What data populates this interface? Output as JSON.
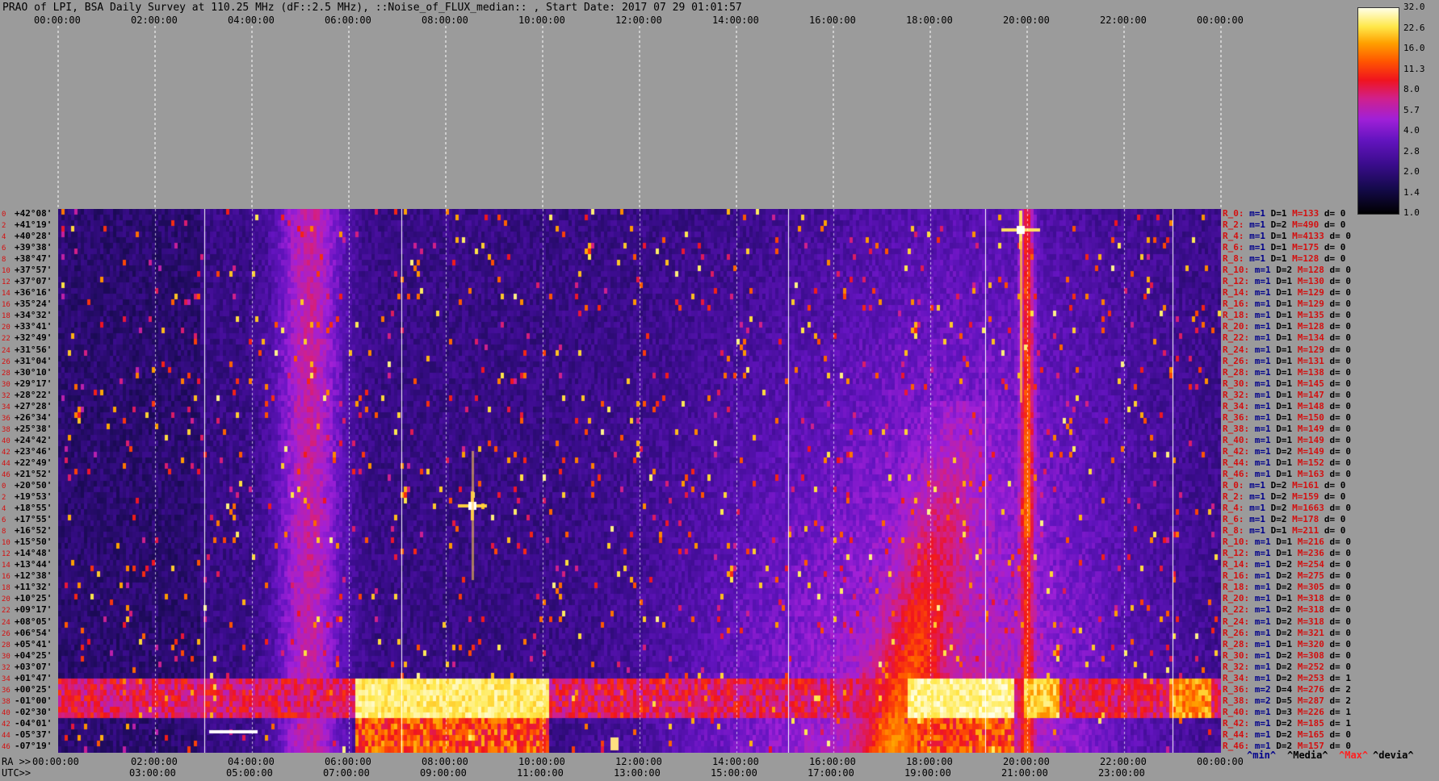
{
  "title": "PRAO of LPI, BSA Daily Survey at 110.25 MHz (dF::2.5 MHz), ::Noise_of_FLUX_median:: , Start Date: 2017 07 29 01:01:57",
  "top_ticks": [
    "00:00:00",
    "02:00:00",
    "04:00:00",
    "06:00:00",
    "08:00:00",
    "10:00:00",
    "12:00:00",
    "14:00:00",
    "16:00:00",
    "18:00:00",
    "20:00:00",
    "22:00:00",
    "00:00:00"
  ],
  "ra_prefix": "RA >>",
  "ra_ticks": [
    "00:00:00",
    "02:00:00",
    "04:00:00",
    "06:00:00",
    "08:00:00",
    "10:00:00",
    "12:00:00",
    "14:00:00",
    "16:00:00",
    "18:00:00",
    "20:00:00",
    "22:00:00",
    "00:00:00"
  ],
  "utc_prefix": "UTC>>",
  "utc_ticks": [
    "03:00:00",
    "05:00:00",
    "07:00:00",
    "09:00:00",
    "11:00:00",
    "13:00:00",
    "15:00:00",
    "17:00:00",
    "19:00:00",
    "21:00:00",
    "23:00:00"
  ],
  "colorbar": {
    "ticks": [
      "32.0",
      "22.6",
      "16.0",
      "11.3",
      "8.0",
      "5.7",
      "4.0",
      "2.8",
      "2.0",
      "1.4",
      "1.0"
    ],
    "gradient": [
      "#000000",
      "#3a0c8c",
      "#a020d8",
      "#f0141e",
      "#ffa000",
      "#ffffe8"
    ]
  },
  "declinations": [
    "+42°08'",
    "+41°19'",
    "+40°28'",
    "+39°38'",
    "+38°47'",
    "+37°57'",
    "+37°07'",
    "+36°16'",
    "+35°24'",
    "+34°32'",
    "+33°41'",
    "+32°49'",
    "+31°56'",
    "+31°04'",
    "+30°10'",
    "+29°17'",
    "+28°22'",
    "+27°28'",
    "+26°34'",
    "+25°38'",
    "+24°42'",
    "+23°46'",
    "+22°49'",
    "+21°52'",
    "+20°50'",
    "+19°53'",
    "+18°55'",
    "+17°55'",
    "+16°52'",
    "+15°50'",
    "+14°48'",
    "+13°44'",
    "+12°38'",
    "+11°32'",
    "+10°25'",
    "+09°17'",
    "+08°05'",
    "+06°54'",
    "+05°41'",
    "+04°25'",
    "+03°07'",
    "+01°47'",
    "+00°25'",
    "-01°00'",
    "-02°30'",
    "-04°01'",
    "-05°37'",
    "-07°19'"
  ],
  "row_indices": [
    "0",
    "2",
    "4",
    "6",
    "8",
    "10",
    "12",
    "14",
    "16",
    "18",
    "20",
    "22",
    "24",
    "26",
    "28",
    "30",
    "32",
    "34",
    "36",
    "38",
    "40",
    "42",
    "44",
    "46",
    "0",
    "2",
    "4",
    "6",
    "8",
    "10",
    "12",
    "14",
    "16",
    "18",
    "20",
    "22",
    "24",
    "26",
    "28",
    "30",
    "32",
    "34",
    "36",
    "38",
    "40",
    "42",
    "44",
    "46"
  ],
  "stats": [
    {
      "r": "R_0:",
      "m": "m=1",
      "D": "D=1",
      "M": "M=133",
      "d": "d= 0"
    },
    {
      "r": "R_2:",
      "m": "m=1",
      "D": "D=2",
      "M": "M=490",
      "d": "d= 0"
    },
    {
      "r": "R_4:",
      "m": "m=1",
      "D": "D=1",
      "M": "M=4133",
      "d": "d= 0"
    },
    {
      "r": "R_6:",
      "m": "m=1",
      "D": "D=1",
      "M": "M=175",
      "d": "d= 0"
    },
    {
      "r": "R_8:",
      "m": "m=1",
      "D": "D=1",
      "M": "M=128",
      "d": "d= 0"
    },
    {
      "r": "R_10:",
      "m": "m=1",
      "D": "D=2",
      "M": "M=128",
      "d": "d= 0"
    },
    {
      "r": "R_12:",
      "m": "m=1",
      "D": "D=1",
      "M": "M=130",
      "d": "d= 0"
    },
    {
      "r": "R_14:",
      "m": "m=1",
      "D": "D=1",
      "M": "M=129",
      "d": "d= 0"
    },
    {
      "r": "R_16:",
      "m": "m=1",
      "D": "D=1",
      "M": "M=129",
      "d": "d= 0"
    },
    {
      "r": "R_18:",
      "m": "m=1",
      "D": "D=1",
      "M": "M=135",
      "d": "d= 0"
    },
    {
      "r": "R_20:",
      "m": "m=1",
      "D": "D=1",
      "M": "M=128",
      "d": "d= 0"
    },
    {
      "r": "R_22:",
      "m": "m=1",
      "D": "D=1",
      "M": "M=134",
      "d": "d= 0"
    },
    {
      "r": "R_24:",
      "m": "m=1",
      "D": "D=1",
      "M": "M=129",
      "d": "d= 0"
    },
    {
      "r": "R_26:",
      "m": "m=1",
      "D": "D=1",
      "M": "M=131",
      "d": "d= 0"
    },
    {
      "r": "R_28:",
      "m": "m=1",
      "D": "D=1",
      "M": "M=138",
      "d": "d= 0"
    },
    {
      "r": "R_30:",
      "m": "m=1",
      "D": "D=1",
      "M": "M=145",
      "d": "d= 0"
    },
    {
      "r": "R_32:",
      "m": "m=1",
      "D": "D=1",
      "M": "M=147",
      "d": "d= 0"
    },
    {
      "r": "R_34:",
      "m": "m=1",
      "D": "D=1",
      "M": "M=148",
      "d": "d= 0"
    },
    {
      "r": "R_36:",
      "m": "m=1",
      "D": "D=1",
      "M": "M=150",
      "d": "d= 0"
    },
    {
      "r": "R_38:",
      "m": "m=1",
      "D": "D=1",
      "M": "M=149",
      "d": "d= 0"
    },
    {
      "r": "R_40:",
      "m": "m=1",
      "D": "D=1",
      "M": "M=149",
      "d": "d= 0"
    },
    {
      "r": "R_42:",
      "m": "m=1",
      "D": "D=2",
      "M": "M=149",
      "d": "d= 0"
    },
    {
      "r": "R_44:",
      "m": "m=1",
      "D": "D=1",
      "M": "M=152",
      "d": "d= 0"
    },
    {
      "r": "R_46:",
      "m": "m=1",
      "D": "D=1",
      "M": "M=163",
      "d": "d= 0"
    },
    {
      "r": "R_0:",
      "m": "m=1",
      "D": "D=2",
      "M": "M=161",
      "d": "d= 0"
    },
    {
      "r": "R_2:",
      "m": "m=1",
      "D": "D=2",
      "M": "M=159",
      "d": "d= 0"
    },
    {
      "r": "R_4:",
      "m": "m=1",
      "D": "D=2",
      "M": "M=1663",
      "d": "d= 0"
    },
    {
      "r": "R_6:",
      "m": "m=1",
      "D": "D=2",
      "M": "M=178",
      "d": "d= 0"
    },
    {
      "r": "R_8:",
      "m": "m=1",
      "D": "D=1",
      "M": "M=211",
      "d": "d= 0"
    },
    {
      "r": "R_10:",
      "m": "m=1",
      "D": "D=1",
      "M": "M=216",
      "d": "d= 0"
    },
    {
      "r": "R_12:",
      "m": "m=1",
      "D": "D=1",
      "M": "M=236",
      "d": "d= 0"
    },
    {
      "r": "R_14:",
      "m": "m=1",
      "D": "D=2",
      "M": "M=254",
      "d": "d= 0"
    },
    {
      "r": "R_16:",
      "m": "m=1",
      "D": "D=2",
      "M": "M=275",
      "d": "d= 0"
    },
    {
      "r": "R_18:",
      "m": "m=1",
      "D": "D=2",
      "M": "M=305",
      "d": "d= 0"
    },
    {
      "r": "R_20:",
      "m": "m=1",
      "D": "D=1",
      "M": "M=318",
      "d": "d= 0"
    },
    {
      "r": "R_22:",
      "m": "m=1",
      "D": "D=2",
      "M": "M=318",
      "d": "d= 0"
    },
    {
      "r": "R_24:",
      "m": "m=1",
      "D": "D=2",
      "M": "M=318",
      "d": "d= 0"
    },
    {
      "r": "R_26:",
      "m": "m=1",
      "D": "D=2",
      "M": "M=321",
      "d": "d= 0"
    },
    {
      "r": "R_28:",
      "m": "m=1",
      "D": "D=1",
      "M": "M=320",
      "d": "d= 0"
    },
    {
      "r": "R_30:",
      "m": "m=1",
      "D": "D=2",
      "M": "M=308",
      "d": "d= 0"
    },
    {
      "r": "R_32:",
      "m": "m=1",
      "D": "D=2",
      "M": "M=252",
      "d": "d= 0"
    },
    {
      "r": "R_34:",
      "m": "m=1",
      "D": "D=2",
      "M": "M=253",
      "d": "d= 1"
    },
    {
      "r": "R_36:",
      "m": "m=2",
      "D": "D=4",
      "M": "M=276",
      "d": "d= 2"
    },
    {
      "r": "R_38:",
      "m": "m=2",
      "D": "D=5",
      "M": "M=287",
      "d": "d= 2"
    },
    {
      "r": "R_40:",
      "m": "m=1",
      "D": "D=3",
      "M": "M=226",
      "d": "d= 1"
    },
    {
      "r": "R_42:",
      "m": "m=1",
      "D": "D=2",
      "M": "M=185",
      "d": "d= 1"
    },
    {
      "r": "R_44:",
      "m": "m=1",
      "D": "D=2",
      "M": "M=165",
      "d": "d= 0"
    },
    {
      "r": "R_46:",
      "m": "m=1",
      "D": "D=2",
      "M": "M=157",
      "d": "d= 0"
    }
  ],
  "legend": {
    "min": "^min^",
    "media": "^Media^",
    "max": "^Max^",
    "devia": "^devia^"
  }
}
